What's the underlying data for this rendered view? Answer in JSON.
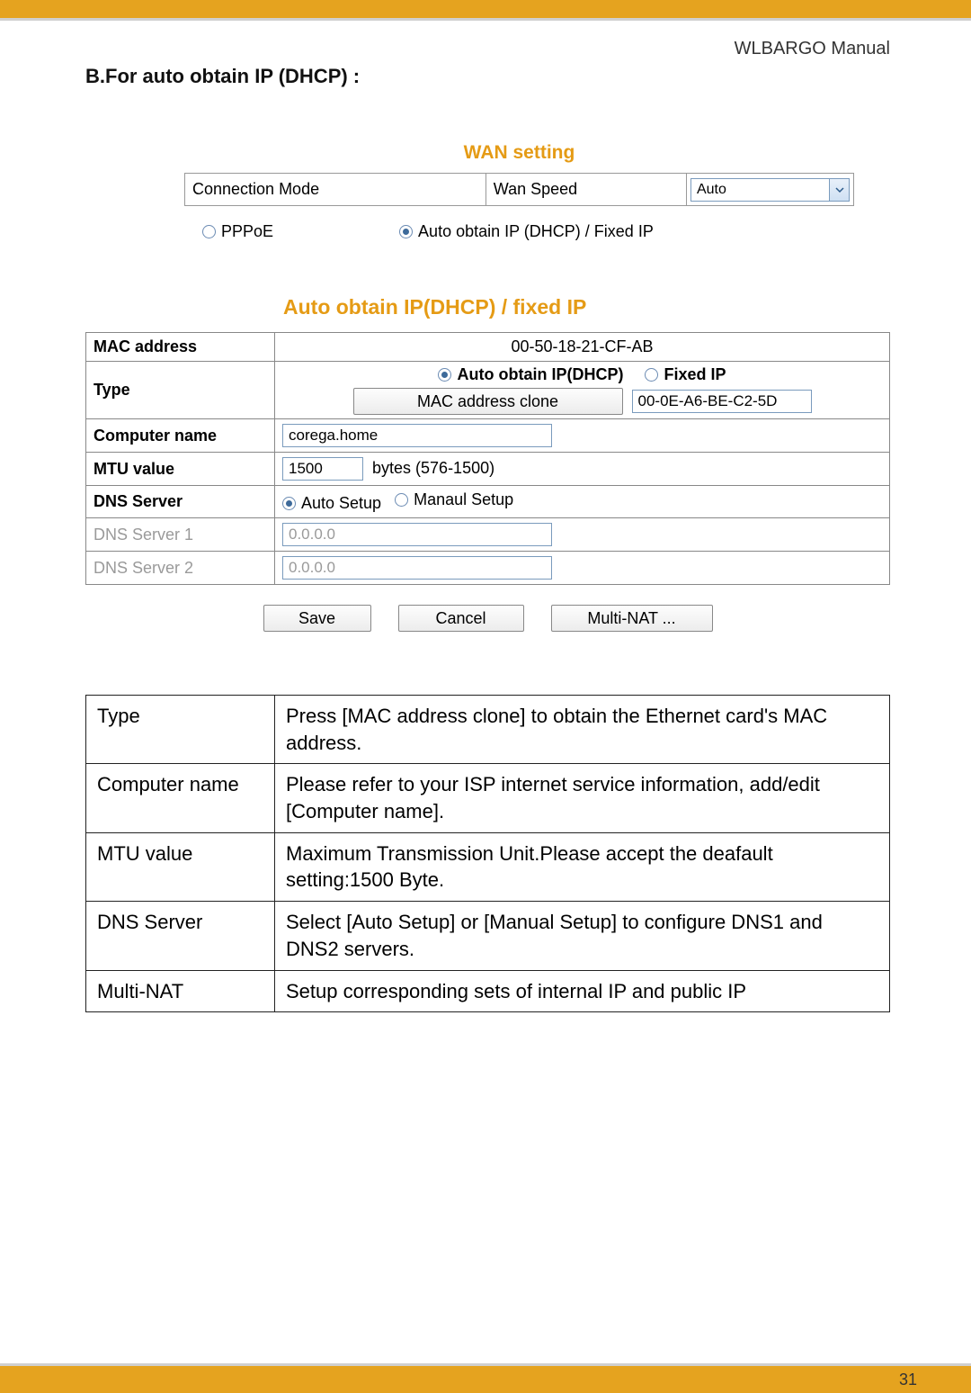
{
  "header": {
    "manual_label": "WLBARGO Manual"
  },
  "section": {
    "heading": "B.For auto obtain IP (DHCP) :"
  },
  "wan": {
    "title": "WAN setting",
    "conn_mode_label": "Connection Mode",
    "wan_speed_label": "Wan Speed",
    "wan_speed_value": "Auto",
    "radio_pppoe": "PPPoE",
    "radio_dhcp": "Auto obtain IP (DHCP) / Fixed IP"
  },
  "auto": {
    "title": "Auto obtain IP(DHCP) / fixed IP",
    "mac_label": "MAC address",
    "mac_value": "00-50-18-21-CF-AB",
    "type_label": "Type",
    "type_auto": "Auto obtain IP(DHCP)",
    "type_fixed": "Fixed IP",
    "mac_clone_btn": "MAC address  clone",
    "mac_clone_value": "00-0E-A6-BE-C2-5D",
    "comp_label": "Computer name",
    "comp_value": "corega.home",
    "mtu_label": "MTU value",
    "mtu_value": "1500",
    "mtu_suffix": "bytes (576-1500)",
    "dns_label": "DNS Server",
    "dns_auto": "Auto Setup",
    "dns_manual": "Manaul Setup",
    "dns1_label": "DNS Server 1",
    "dns1_value": "0.0.0.0",
    "dns2_label": "DNS Server 2",
    "dns2_value": "0.0.0.0",
    "btn_save": "Save",
    "btn_cancel": "Cancel",
    "btn_multinat": "Multi-NAT ..."
  },
  "desc": {
    "rows": [
      {
        "k": "Type",
        "v": "Press [MAC address clone] to obtain the Ethernet card's MAC address."
      },
      {
        "k": "Computer name",
        "v": "Please refer to your ISP internet service information, add/edit [Computer name]."
      },
      {
        "k": "MTU value",
        "v": "Maximum Transmission Unit.Please accept the deafault setting:1500 Byte."
      },
      {
        "k": "DNS Server",
        "v": "Select [Auto Setup] or [Manual Setup] to configure DNS1 and DNS2 servers."
      },
      {
        "k": "Multi-NAT",
        "v": "Setup corresponding sets of internal IP and public IP"
      }
    ]
  },
  "footer": {
    "page_number": "31"
  }
}
